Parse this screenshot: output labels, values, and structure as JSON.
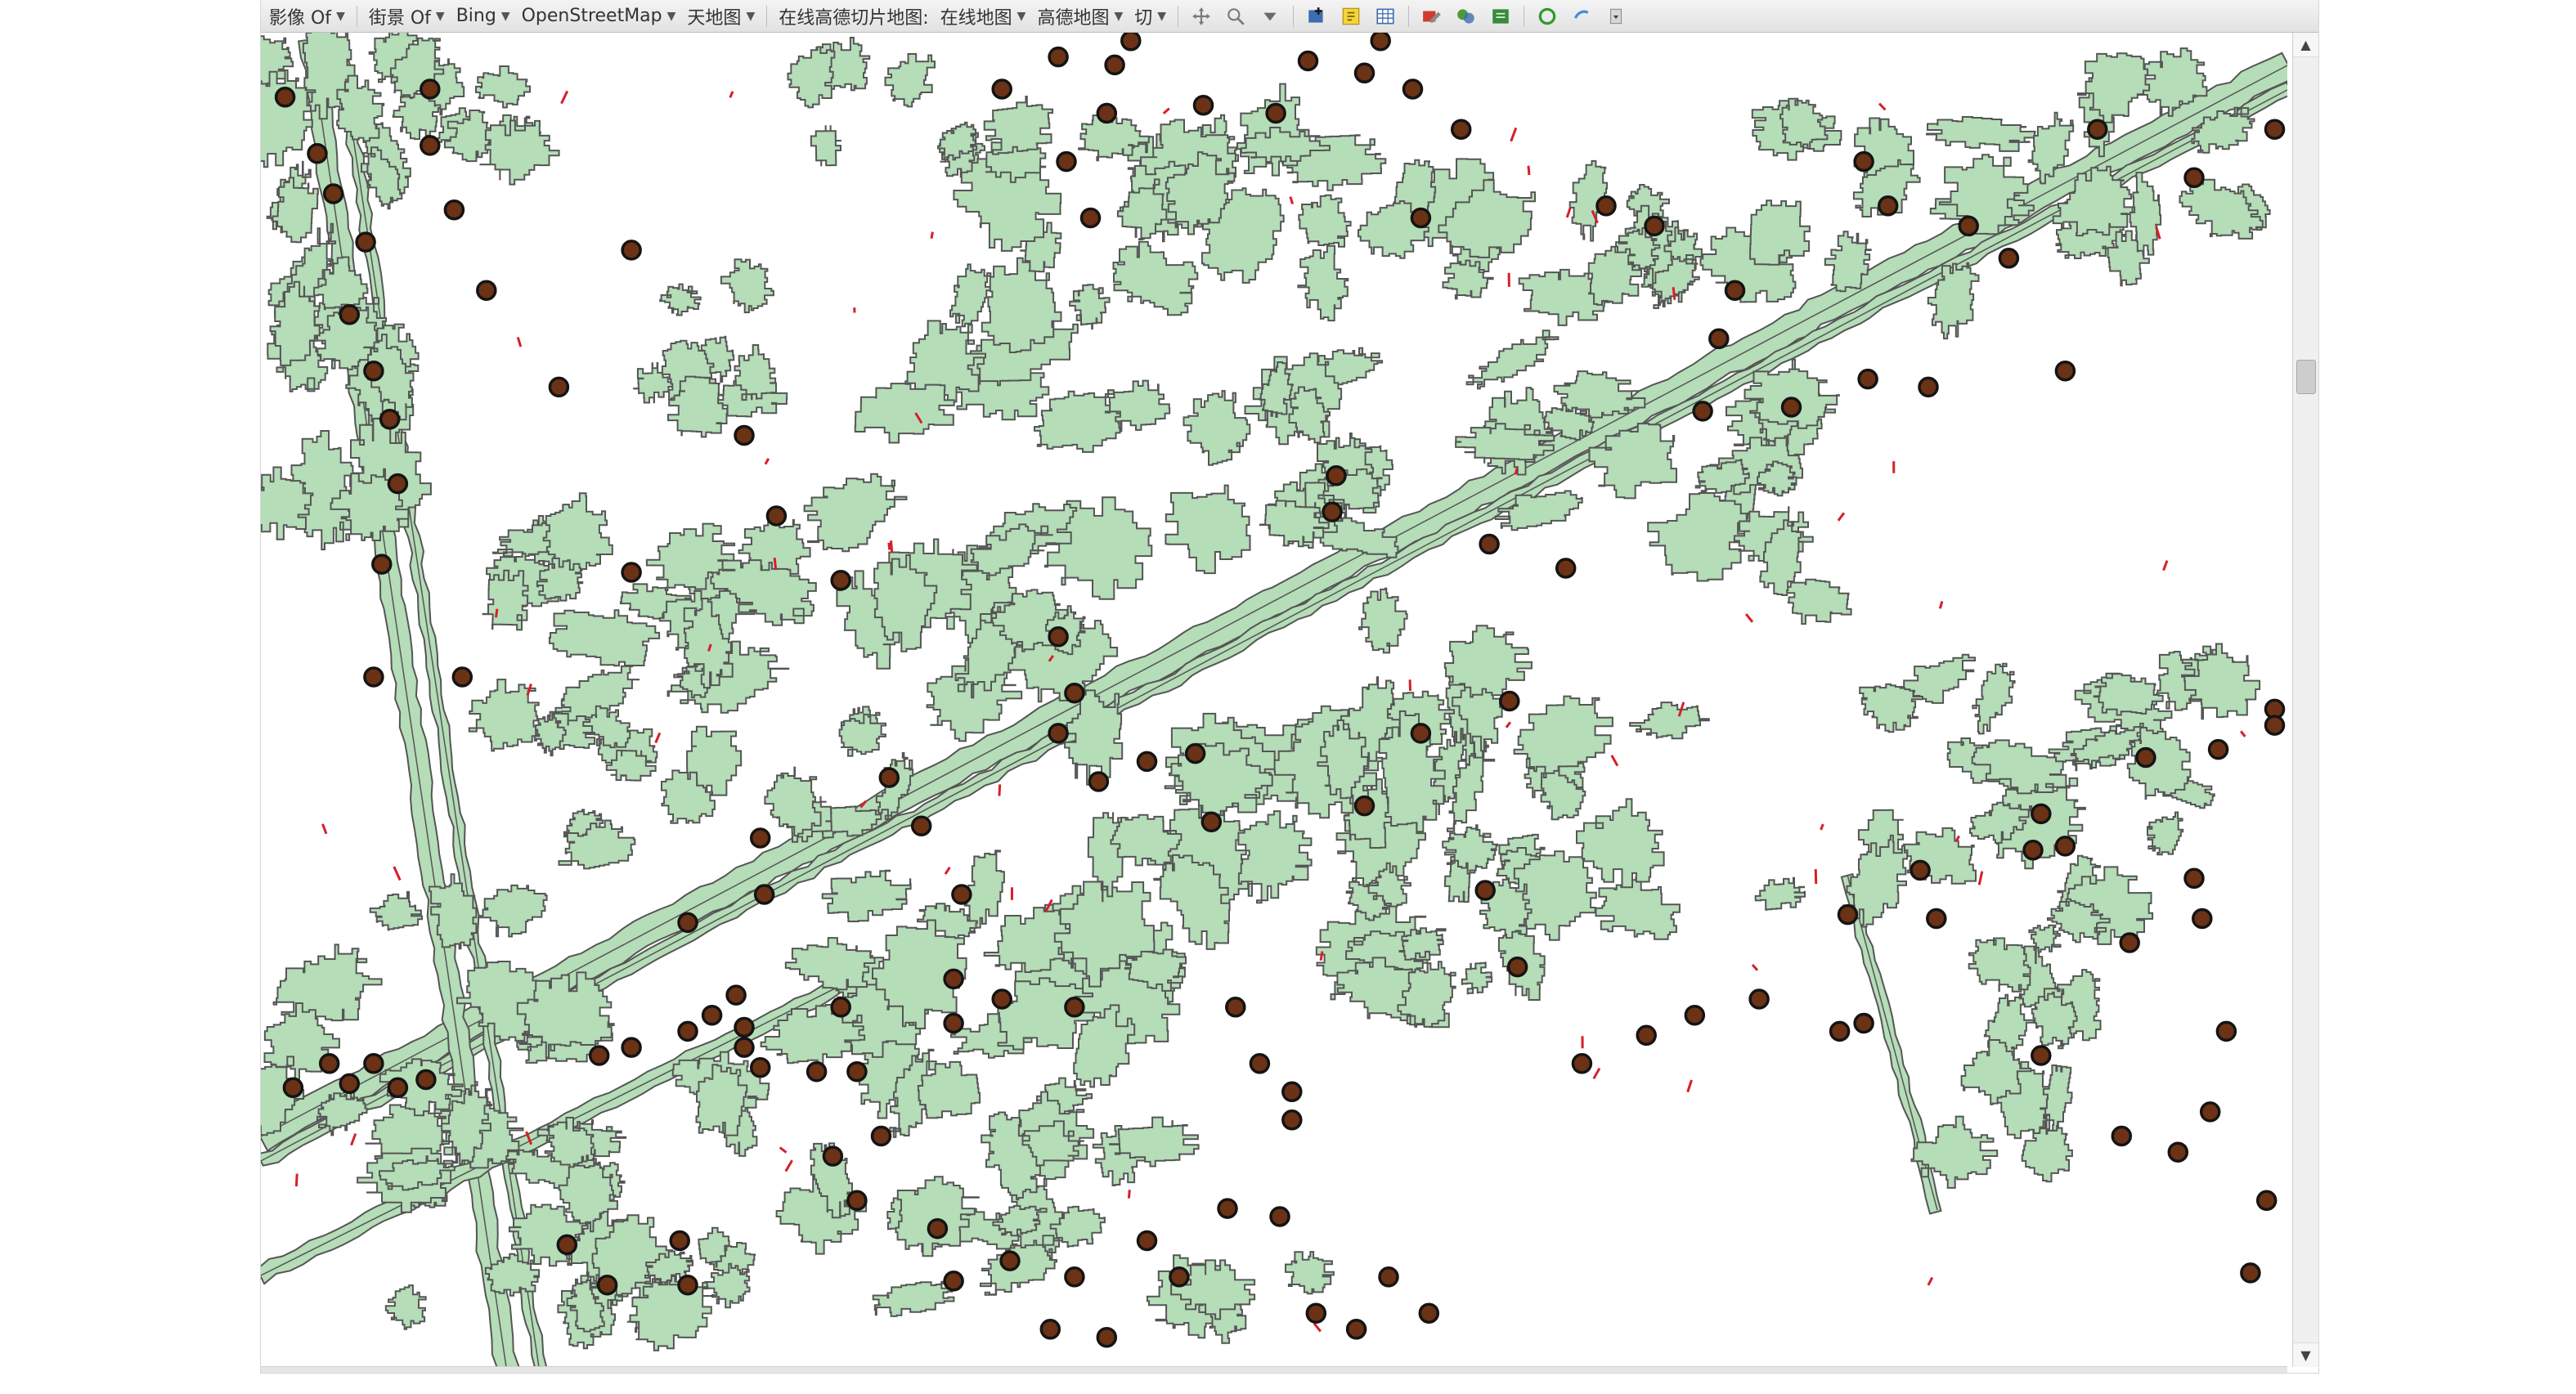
{
  "toolbar": {
    "items": [
      {
        "label": "影像 Of",
        "has_caret": true
      },
      {
        "label": "街景 Of",
        "has_caret": true
      },
      {
        "label": "Bing",
        "has_caret": true
      },
      {
        "label": "OpenStreetMap",
        "has_caret": true
      },
      {
        "label": "天地图",
        "has_caret": true
      },
      {
        "label": "在线高德切片地图:",
        "has_caret": false
      },
      {
        "label": "在线地图",
        "has_caret": true
      },
      {
        "label": "高德地图",
        "has_caret": true
      },
      {
        "label": "切",
        "has_caret": true
      }
    ],
    "icons": [
      "pan-icon",
      "zoom-icon",
      "dropdown-arrow-icon",
      "add-layer-icon",
      "identify-icon",
      "table-icon",
      "edit-icon",
      "layers-icon",
      "export-icon",
      "refresh-icon",
      "help-icon",
      "more-icon"
    ]
  },
  "colors": {
    "parcel_fill": "#b5ddb8",
    "parcel_stroke": "#555555",
    "road_fill": "#b5ddb8",
    "point_fill": "#6b3215",
    "point_stroke": "#141414",
    "change_marker": "#d61f2a",
    "toolbar_bg": "#ececec"
  },
  "map": {
    "symbol": "brown point with dark outline",
    "layers": [
      "polygons",
      "points",
      "change-markers"
    ]
  },
  "scrollbars": {
    "vertical": {
      "up_icon": "arrow-up-icon",
      "down_icon": "arrow-down-icon"
    }
  }
}
